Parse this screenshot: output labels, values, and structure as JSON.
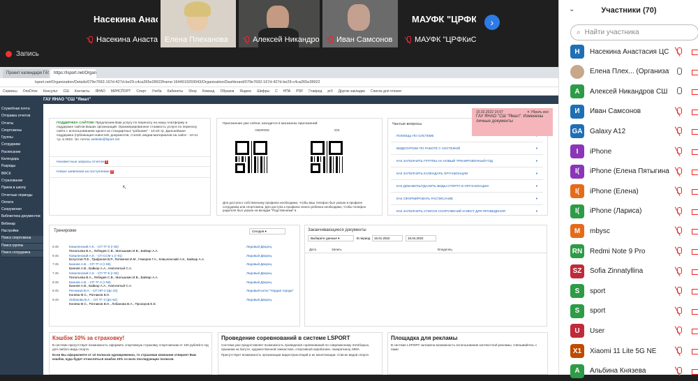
{
  "meeting": {
    "tiles": [
      {
        "name": "Насекина Анастасия ЦСП ...",
        "big": "Насекина Анас...",
        "muted": true
      },
      {
        "name": "Елена Плеханова",
        "muted": false
      },
      {
        "name": "Алексей Никандров СШ...",
        "muted": true
      },
      {
        "name": "Иван Самсонов",
        "muted": true
      },
      {
        "name": "МАУФК \"ЦРФКиС\" ...",
        "big": "МАУФК \"ЦРФК...",
        "muted": true
      }
    ],
    "record_label": "Запись",
    "next_icon": "chevron-right-icon"
  },
  "browser": {
    "tabs": [
      "Проект календаря ГАУ ЯНАО ...",
      "https://lsport.net/Organization/..."
    ],
    "url": "lsport.net/Organization/Details/079e7692-167d-427d-be29-c4ca265e28922frame:1644919293043/Organization/Dashboard/079e7692-167d-427d-be29-c4ca265e28922",
    "bookmarks": [
      "Сервисы",
      "OneDrive",
      "Консульт",
      "СШ",
      "Контакты",
      "ЯНАО",
      "МИНСПОРТ",
      "Спорт",
      "Учеба",
      "Кабинеты",
      "Shop",
      "Команд",
      "Образов",
      "Яндекс",
      "Шифры",
      "С",
      "НПА",
      "PDF",
      "Главред",
      "pr0",
      "Другие закладки",
      "Список для чтения"
    ]
  },
  "site": {
    "header": "ГАУ ЯНАО \"СШ \"Ямал\"",
    "menu": [
      "Служебная почта",
      "Отправка отчетов",
      "Отчеты",
      "Спортсмены",
      "Группы",
      "Сотрудники",
      "Расписание",
      "Календарь",
      "Разряды",
      "ВФСК",
      "Страхование",
      "Прием в школу",
      "Отчетные периоды",
      "Оплата",
      "Сооружения",
      "Библиотека документов",
      "Вебинар",
      "Настройки"
    ],
    "submenu": [
      "Поиск спортсмена",
      "Поиск группы",
      "Поиск сотрудника"
    ],
    "support": {
      "title": "ПОДДЕРЖКА САЙТОВ!",
      "text": "Предлагаем Вам услугу по переносу на нашу платформу и поддержке сайтов Ваших организаций. Оранжерированное стоимость услуги по переносу сайта с использованием одного из стандартных \"робшаек\" - 10-20 тр. Дальнейшая поддержка (публикация новостей, документов, статей, медиа-материалов на сайте - 10-11 т.р. в 2022. Эл. почта:",
      "email": "website@lsport.net",
      "link1": "Неизвестные запросы отчетов",
      "link2": "Новые заявления на поступление"
    },
    "apps": {
      "title": "Приложение уже сейчас находится в магазинах приложений:",
      "android": "ANDROID",
      "ios": "iOS",
      "note": "Для доступа к собственному профилю необходимо, чтобы ваш телефон был указан в профиле сотрудника или спортсмена. Для доступа к профилю своего ребенка необходимо, чтобы телефон родителя был указан на вкладке \"Родственники\" в"
    },
    "faq": {
      "title": "Частые вопросы",
      "items": [
        "ПОМОЩЬ ПО СИСТЕМЕ",
        "ВИДЕОУРОКИ ПО РАБОТЕ С СИСТЕМОЙ",
        "КАК ЗАПОЛНИТЬ ГРУППЫ НА НОВЫЙ ТРЕНИРОВОЧНЫЙ ГОД",
        "КАК ЗАПОЛНИТЬ КАЛЕНДАРЬ ОРГАНИЗАЦИИ",
        "КАК ДОБАВИТЬ/УДАЛИТЬ ВИДЫ СПОРТА В ОРГАНИЗАЦИИ",
        "КАК СФОРМИРОВАТЬ РАСПИСАНИЕ",
        "КАК ЗАПОЛНИТЬ СПИСОК СООРУЖЕНИЙ И МЕСТ ДЛЯ ПРОВЕДЕНИЯ"
      ]
    },
    "toast": {
      "date": "15.02.2022 15:07",
      "text": "ГАУ ЯНАО \"СШ \"Ямал\": Изменены личные документы",
      "close": "Убрать все"
    },
    "trainings": {
      "title": "Тренировки",
      "select": "Сегодня",
      "rows": [
        {
          "t": "6:45",
          "c": "Коваленский А.К. - СП ТГ-5 (г-82)",
          "s": "Пилатьева В.А., Лебедев С.В., Малышкин И.В., Байкар А.А.",
          "p": "Ледовый Дворец"
        },
        {
          "t": "6:45",
          "c": "Коваленский А.К. - СП ССМ-1 (г-91)",
          "s": "Богуслов П.Е., Трифонов В.Р., Литвинов И.М., Гемерев Г.А., Ковыленский А.К., Байкар А.А.",
          "p": "Ледовый Дворец"
        },
        {
          "t": "7:45",
          "c": "Баннев А.В. - СП ТГ-2 (г-59)",
          "s": "Баннев А.В., Байкар А.А., Наполитый С.А.",
          "p": "Ледовый Дворец"
        },
        {
          "t": "7:45",
          "c": "Коваленский А.К. - СП ТГ-5 (г-82)",
          "s": "Пилатьева В.А., Лебедев С.В., Малышкин И.В., Байкар А.А.",
          "p": "Ледовый Дворец"
        },
        {
          "t": "8:45",
          "c": "Баннев А.В. - СП ТГ-2 (г-59)",
          "s": "Баннев А.В., Байкар А.А., Наполитый С.А.",
          "p": "Ледовый Дворец"
        },
        {
          "t": "8:45",
          "c": "Ратников В.Н. - СП НП-2 (фс-32)",
          "s": "Конева М.С., Ратников В.Н.",
          "p": "Ледовый каток \"Чердая города\""
        },
        {
          "t": "9:45",
          "c": "Лобанова В.А. - СП ТГ-2 (фс-52)",
          "s": "Конева М.С., Ратников В.Н., Лобанова В.А., Прохоров Е.Е.",
          "p": "Ледовый Дворец"
        }
      ]
    },
    "docs": {
      "title": "Заканчивающиеся документы",
      "select": "Выберите данные",
      "period": "В период",
      "from": "15.01.2022",
      "to": "15.04.2022",
      "cols": [
        "Дата",
        "Запись",
        "Владелец"
      ]
    },
    "promo": [
      {
        "title": "Кэшбэк 10% за страховку!",
        "text": "В системе присутствует возможность оформить спортивную страховку спортсменам от 100 рублей в год для любого вида спорта.",
        "text2": "Если Вы оформляете от 10 полисов одновременно, то страховая компания отвернет Вам кэшбэк, куда будет отчисляться кэшбэк 10% со всех последующих полисов"
      },
      {
        "title": "Проведение соревнований в системе LSPORT",
        "text": "Система уже предоставляет возможность проведения соревнований по современному пятиборью, прыжкам на батуте, художественной гимнастике, спортивной акробатике, панкратиону, ММА",
        "text2": "Присутствует возможность организации видеотрансляций и их монетизации. Список видов спорта"
      },
      {
        "title": "Площадка для рекламы",
        "text": "В системе LSPORT заложена возможность использования контекстной рекламы. Связывайтесь с нами"
      }
    ]
  },
  "participants": {
    "title": "Участники (70)",
    "search_placeholder": "Найти участника",
    "list": [
      {
        "initials": "Н",
        "name": "Насекина Анастасия ЦСП ... (Я)",
        "color": "#1f6fb5",
        "mic": "muted"
      },
      {
        "initials": "",
        "name": "Елена Плех... (Организатор)",
        "color": "#c8a88a",
        "mic": "on",
        "photo": true
      },
      {
        "initials": "А",
        "name": "Алексей Никандров СШ Я...",
        "color": "#2e9b47",
        "mic": "on"
      },
      {
        "initials": "И",
        "name": "Иван Самсонов",
        "color": "#1f6fb5",
        "mic": "muted"
      },
      {
        "initials": "GA",
        "name": "Galaxy A12",
        "color": "#1f6fb5",
        "mic": "muted"
      },
      {
        "initials": "I",
        "name": "iPhone",
        "color": "#8b35b8",
        "mic": "muted"
      },
      {
        "initials": "I(",
        "name": "iPhone (Елена Пятыгина (МАУ...",
        "color": "#8b35b8",
        "mic": "muted"
      },
      {
        "initials": "I(",
        "name": "iPhone (Елена)",
        "color": "#e56a1a",
        "mic": "muted"
      },
      {
        "initials": "I(",
        "name": "iPhone (Лариса)",
        "color": "#2e9b47",
        "mic": "muted"
      },
      {
        "initials": "M",
        "name": "mbysc",
        "color": "#e56a1a",
        "mic": "muted"
      },
      {
        "initials": "RN",
        "name": "Redmi Note 9 Pro",
        "color": "#2e9b47",
        "mic": "muted"
      },
      {
        "initials": "SZ",
        "name": "Sofia Zinnatyllina",
        "color": "#c02a3a",
        "mic": "muted"
      },
      {
        "initials": "S",
        "name": "sport",
        "color": "#2e9b47",
        "mic": "muted"
      },
      {
        "initials": "S",
        "name": "sport",
        "color": "#2e9b47",
        "mic": "muted"
      },
      {
        "initials": "U",
        "name": "User",
        "color": "#c02a3a",
        "mic": "muted"
      },
      {
        "initials": "X1",
        "name": "Xiaomi 11 Lite 5G NE",
        "color": "#c04a00",
        "mic": "muted"
      },
      {
        "initials": "А",
        "name": "Альбина Князева",
        "color": "#2e9b47",
        "mic": "muted"
      }
    ]
  }
}
